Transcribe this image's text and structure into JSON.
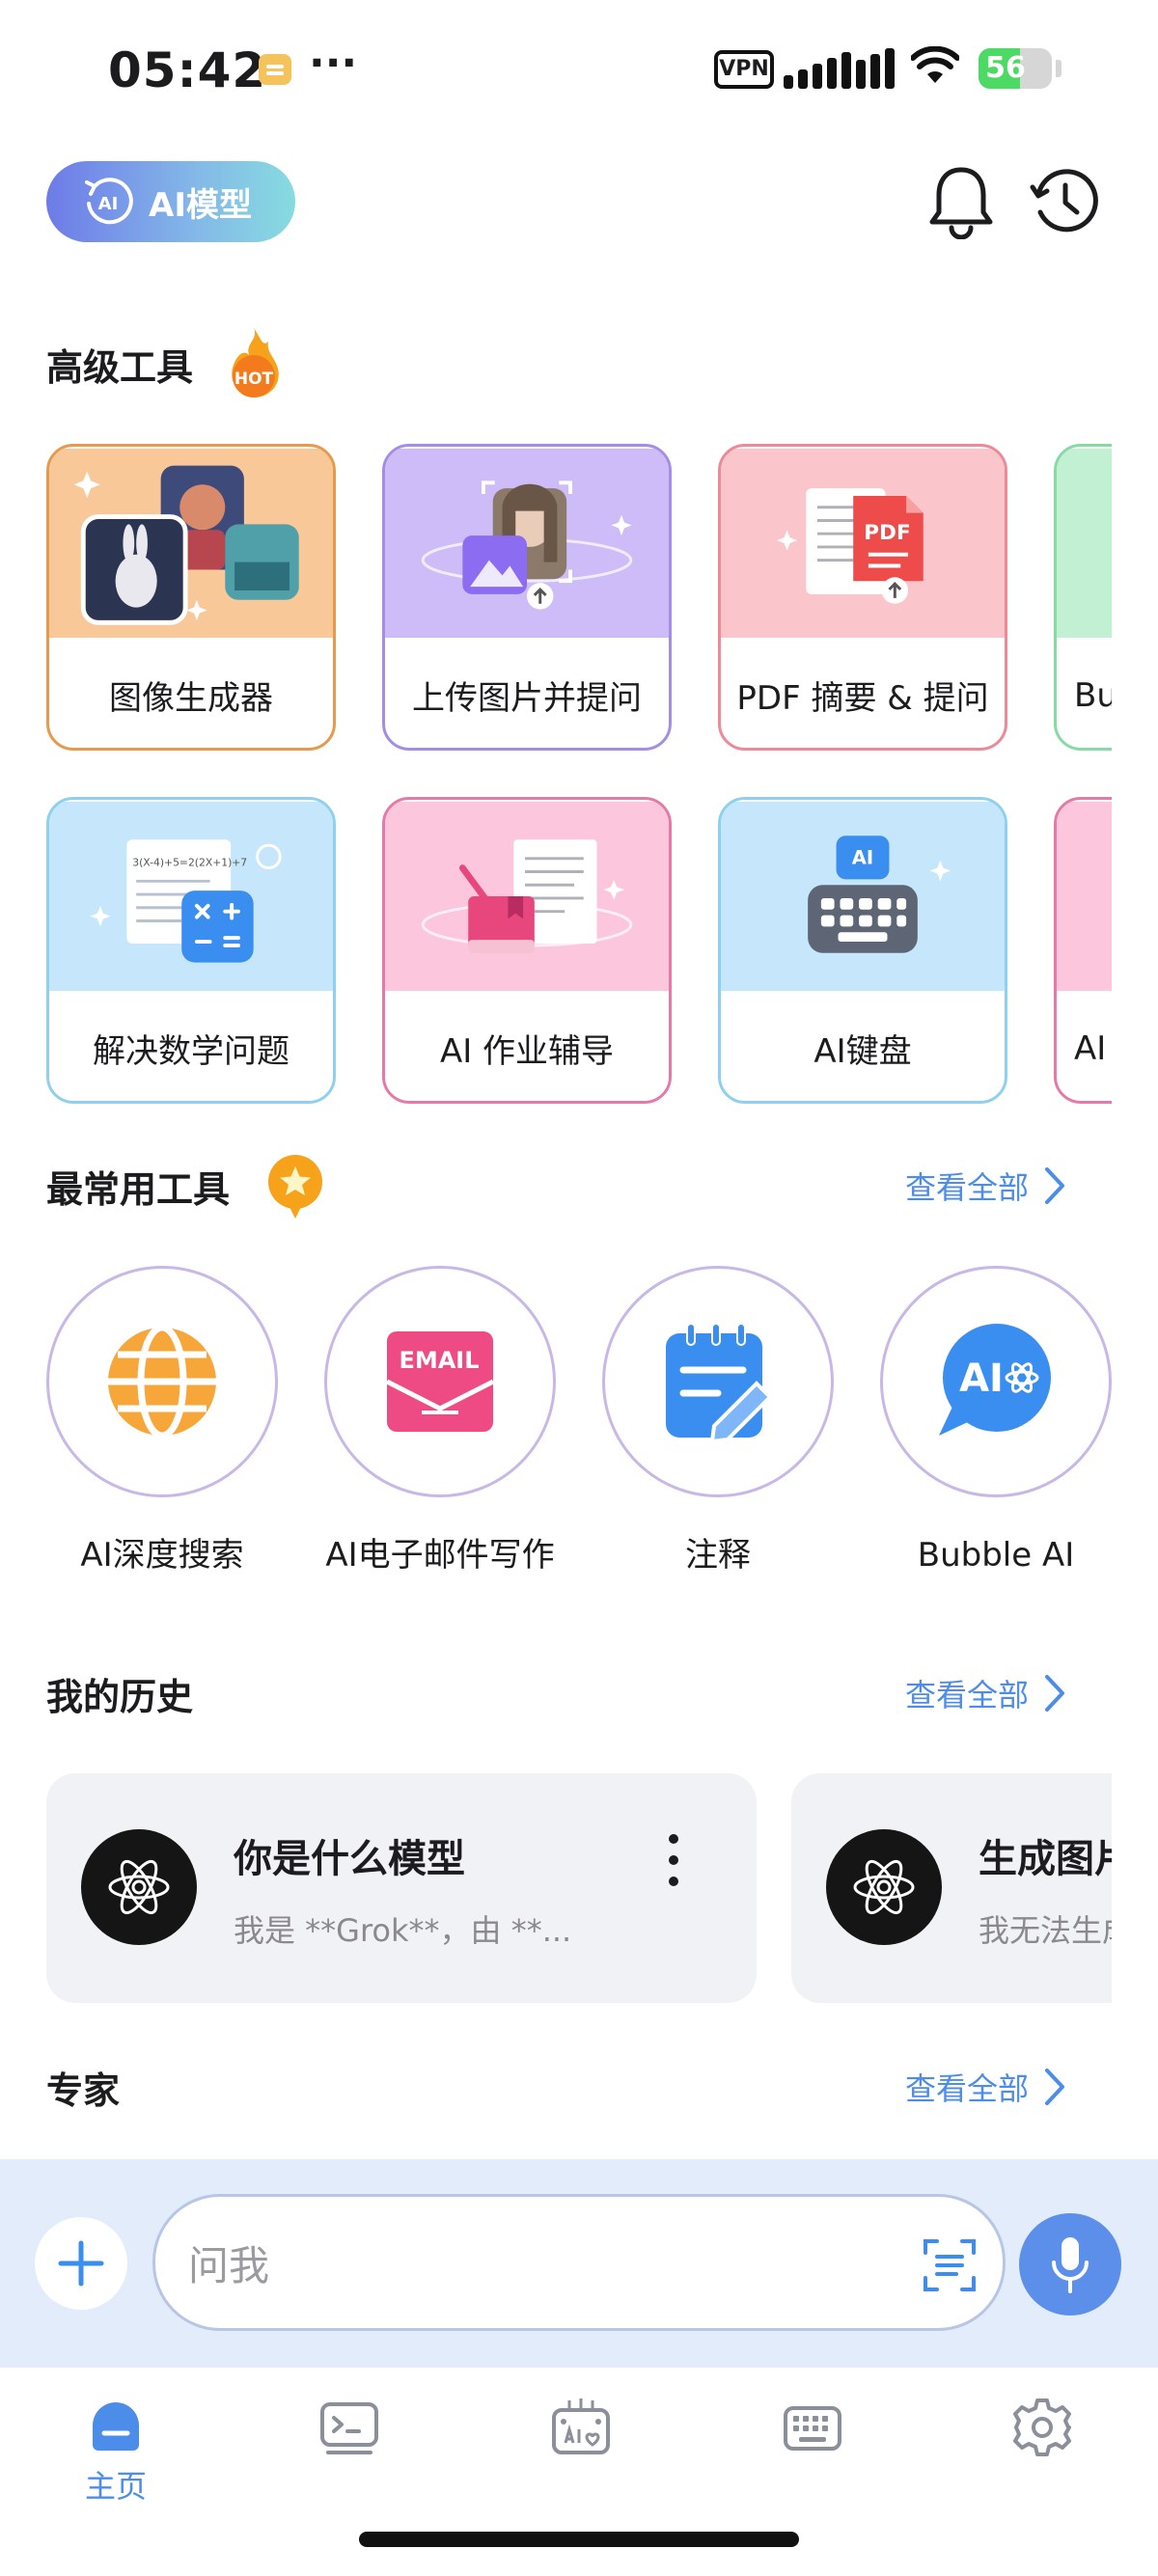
{
  "status_bar": {
    "time": "05:42",
    "more": "···",
    "vpn": "VPN",
    "battery": "56",
    "battery_level": 0.56
  },
  "header": {
    "model_button_icon_text": "AI",
    "model_button_label": "AI模型",
    "notification_icon": "bell-icon",
    "history_icon": "history-clock-icon"
  },
  "advanced_tools": {
    "title": "高级工具",
    "badge": "HOT",
    "row1": [
      {
        "label": "图像生成器",
        "border": "#e59a4d",
        "bg": "#f8c898"
      },
      {
        "label": "上传图片并提问",
        "border": "#a48ee4",
        "bg": "#cdbcf7"
      },
      {
        "label": "PDF 摘要 & 提问",
        "border": "#ec8a98",
        "bg": "#fbc5cc"
      },
      {
        "label": "Bu",
        "border": "#87d9a5",
        "bg": "#c2f0d2"
      }
    ],
    "row2": [
      {
        "label": "解决数学问题",
        "border": "#8ed0ee",
        "bg": "#c5e6fb"
      },
      {
        "label": "AI 作业辅导",
        "border": "#e47aa8",
        "bg": "#fcc6dc"
      },
      {
        "label": "AI键盘",
        "border": "#8ed0ee",
        "bg": "#c5e6fb"
      },
      {
        "label": "AI",
        "border": "#e47aa8",
        "bg": "#fcc6dc"
      }
    ],
    "pdf_badge": "PDF",
    "ai_key_badge": "AI",
    "math_formula": "3(X-4)+5=2(2X+1)+7"
  },
  "common_tools": {
    "title": "最常用工具",
    "see_all": "查看全部",
    "items": [
      {
        "label": "AI深度搜索",
        "icon": "globe-icon"
      },
      {
        "label": "AI电子邮件写作",
        "icon": "email-icon",
        "icon_text": "EMAIL"
      },
      {
        "label": "注释",
        "icon": "notepad-pen-icon"
      },
      {
        "label": "Bubble AI",
        "icon": "ai-chat-bubble-icon",
        "icon_text": "AI"
      }
    ]
  },
  "history": {
    "title": "我的历史",
    "see_all": "查看全部",
    "items": [
      {
        "title": "你是什么模型",
        "preview": "我是 **Grok**，由 **..."
      },
      {
        "title": "生成图片",
        "preview": "我无法生成"
      }
    ]
  },
  "experts": {
    "title": "专家",
    "see_all": "查看全部"
  },
  "composer": {
    "placeholder": "问我"
  },
  "bottom_nav": {
    "home_label": "主页",
    "items": [
      "home-icon",
      "terminal-icon",
      "ai-keyboard-icon",
      "keyboard-icon",
      "settings-gear-icon"
    ]
  },
  "colors": {
    "accent": "#4b8de8",
    "pill_gradient_start": "#6d7be8",
    "pill_gradient_end": "#86dbe0",
    "composer_bg": "#e3ecfb"
  }
}
